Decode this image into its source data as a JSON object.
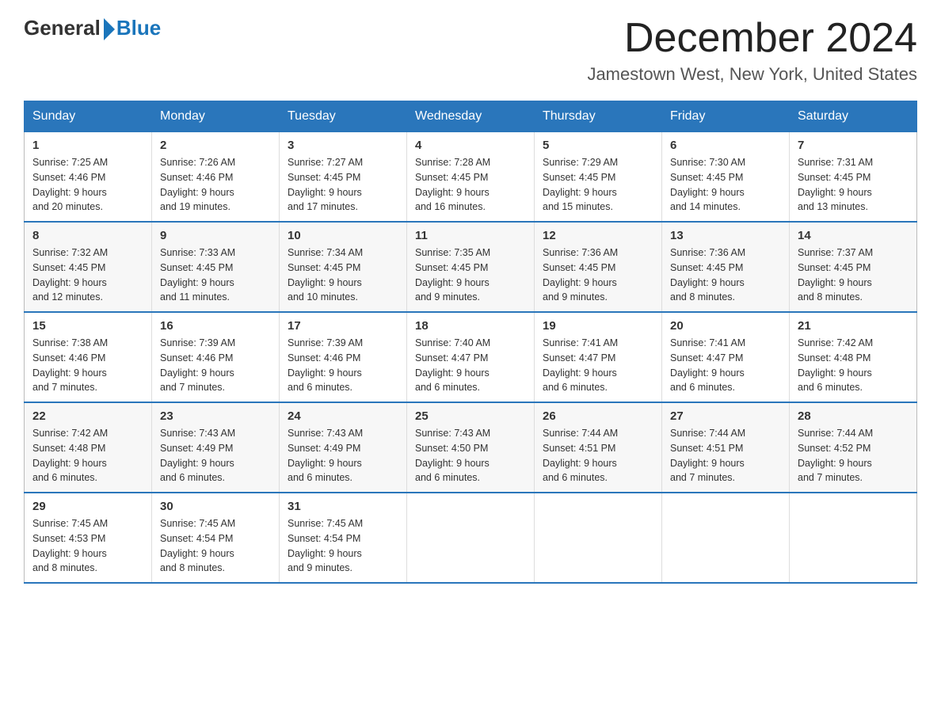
{
  "header": {
    "logo_general": "General",
    "logo_blue": "Blue",
    "month_title": "December 2024",
    "location": "Jamestown West, New York, United States"
  },
  "days_of_week": [
    "Sunday",
    "Monday",
    "Tuesday",
    "Wednesday",
    "Thursday",
    "Friday",
    "Saturday"
  ],
  "weeks": [
    [
      {
        "day": "1",
        "sunrise": "7:25 AM",
        "sunset": "4:46 PM",
        "daylight": "9 hours and 20 minutes."
      },
      {
        "day": "2",
        "sunrise": "7:26 AM",
        "sunset": "4:46 PM",
        "daylight": "9 hours and 19 minutes."
      },
      {
        "day": "3",
        "sunrise": "7:27 AM",
        "sunset": "4:45 PM",
        "daylight": "9 hours and 17 minutes."
      },
      {
        "day": "4",
        "sunrise": "7:28 AM",
        "sunset": "4:45 PM",
        "daylight": "9 hours and 16 minutes."
      },
      {
        "day": "5",
        "sunrise": "7:29 AM",
        "sunset": "4:45 PM",
        "daylight": "9 hours and 15 minutes."
      },
      {
        "day": "6",
        "sunrise": "7:30 AM",
        "sunset": "4:45 PM",
        "daylight": "9 hours and 14 minutes."
      },
      {
        "day": "7",
        "sunrise": "7:31 AM",
        "sunset": "4:45 PM",
        "daylight": "9 hours and 13 minutes."
      }
    ],
    [
      {
        "day": "8",
        "sunrise": "7:32 AM",
        "sunset": "4:45 PM",
        "daylight": "9 hours and 12 minutes."
      },
      {
        "day": "9",
        "sunrise": "7:33 AM",
        "sunset": "4:45 PM",
        "daylight": "9 hours and 11 minutes."
      },
      {
        "day": "10",
        "sunrise": "7:34 AM",
        "sunset": "4:45 PM",
        "daylight": "9 hours and 10 minutes."
      },
      {
        "day": "11",
        "sunrise": "7:35 AM",
        "sunset": "4:45 PM",
        "daylight": "9 hours and 9 minutes."
      },
      {
        "day": "12",
        "sunrise": "7:36 AM",
        "sunset": "4:45 PM",
        "daylight": "9 hours and 9 minutes."
      },
      {
        "day": "13",
        "sunrise": "7:36 AM",
        "sunset": "4:45 PM",
        "daylight": "9 hours and 8 minutes."
      },
      {
        "day": "14",
        "sunrise": "7:37 AM",
        "sunset": "4:45 PM",
        "daylight": "9 hours and 8 minutes."
      }
    ],
    [
      {
        "day": "15",
        "sunrise": "7:38 AM",
        "sunset": "4:46 PM",
        "daylight": "9 hours and 7 minutes."
      },
      {
        "day": "16",
        "sunrise": "7:39 AM",
        "sunset": "4:46 PM",
        "daylight": "9 hours and 7 minutes."
      },
      {
        "day": "17",
        "sunrise": "7:39 AM",
        "sunset": "4:46 PM",
        "daylight": "9 hours and 6 minutes."
      },
      {
        "day": "18",
        "sunrise": "7:40 AM",
        "sunset": "4:47 PM",
        "daylight": "9 hours and 6 minutes."
      },
      {
        "day": "19",
        "sunrise": "7:41 AM",
        "sunset": "4:47 PM",
        "daylight": "9 hours and 6 minutes."
      },
      {
        "day": "20",
        "sunrise": "7:41 AM",
        "sunset": "4:47 PM",
        "daylight": "9 hours and 6 minutes."
      },
      {
        "day": "21",
        "sunrise": "7:42 AM",
        "sunset": "4:48 PM",
        "daylight": "9 hours and 6 minutes."
      }
    ],
    [
      {
        "day": "22",
        "sunrise": "7:42 AM",
        "sunset": "4:48 PM",
        "daylight": "9 hours and 6 minutes."
      },
      {
        "day": "23",
        "sunrise": "7:43 AM",
        "sunset": "4:49 PM",
        "daylight": "9 hours and 6 minutes."
      },
      {
        "day": "24",
        "sunrise": "7:43 AM",
        "sunset": "4:49 PM",
        "daylight": "9 hours and 6 minutes."
      },
      {
        "day": "25",
        "sunrise": "7:43 AM",
        "sunset": "4:50 PM",
        "daylight": "9 hours and 6 minutes."
      },
      {
        "day": "26",
        "sunrise": "7:44 AM",
        "sunset": "4:51 PM",
        "daylight": "9 hours and 6 minutes."
      },
      {
        "day": "27",
        "sunrise": "7:44 AM",
        "sunset": "4:51 PM",
        "daylight": "9 hours and 7 minutes."
      },
      {
        "day": "28",
        "sunrise": "7:44 AM",
        "sunset": "4:52 PM",
        "daylight": "9 hours and 7 minutes."
      }
    ],
    [
      {
        "day": "29",
        "sunrise": "7:45 AM",
        "sunset": "4:53 PM",
        "daylight": "9 hours and 8 minutes."
      },
      {
        "day": "30",
        "sunrise": "7:45 AM",
        "sunset": "4:54 PM",
        "daylight": "9 hours and 8 minutes."
      },
      {
        "day": "31",
        "sunrise": "7:45 AM",
        "sunset": "4:54 PM",
        "daylight": "9 hours and 9 minutes."
      },
      null,
      null,
      null,
      null
    ]
  ],
  "labels": {
    "sunrise": "Sunrise:",
    "sunset": "Sunset:",
    "daylight": "Daylight:"
  }
}
